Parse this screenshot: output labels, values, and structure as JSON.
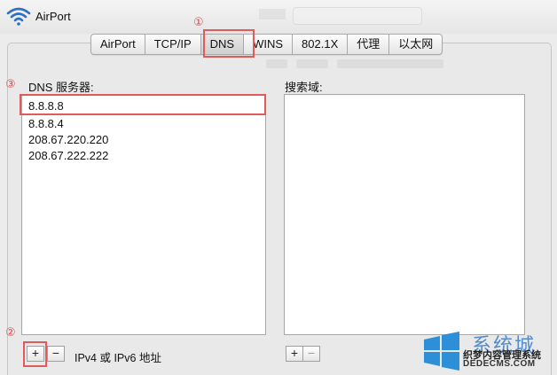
{
  "window": {
    "title": "AirPort"
  },
  "tabs": [
    {
      "label": "AirPort",
      "active": false
    },
    {
      "label": "TCP/IP",
      "active": false
    },
    {
      "label": "DNS",
      "active": true
    },
    {
      "label": "WINS",
      "active": false
    },
    {
      "label": "802.1X",
      "active": false
    },
    {
      "label": "代理",
      "active": false
    },
    {
      "label": "以太网",
      "active": false
    }
  ],
  "annotations": {
    "marker1": "①",
    "marker2": "②",
    "marker3": "③",
    "color": "#e35a5a"
  },
  "dns": {
    "label": "DNS 服务器:",
    "servers": [
      "8.8.8.8",
      "8.8.8.4",
      "208.67.220.220",
      "208.67.222.222"
    ],
    "add_label": "+",
    "remove_label": "−",
    "hint": "IPv4 或 IPv6 地址"
  },
  "search": {
    "label": "搜索域:",
    "add_label": "+",
    "remove_label": "−"
  },
  "watermark": {
    "brand": "系统城",
    "line": "织梦内容管理系统",
    "url": "DEDECMS.COM"
  },
  "icons": {
    "wifi": "wifi-icon",
    "logo": "windows-logo-icon"
  },
  "colors": {
    "accent_blue": "#3a7cc8",
    "highlight": "#e35a5a"
  }
}
